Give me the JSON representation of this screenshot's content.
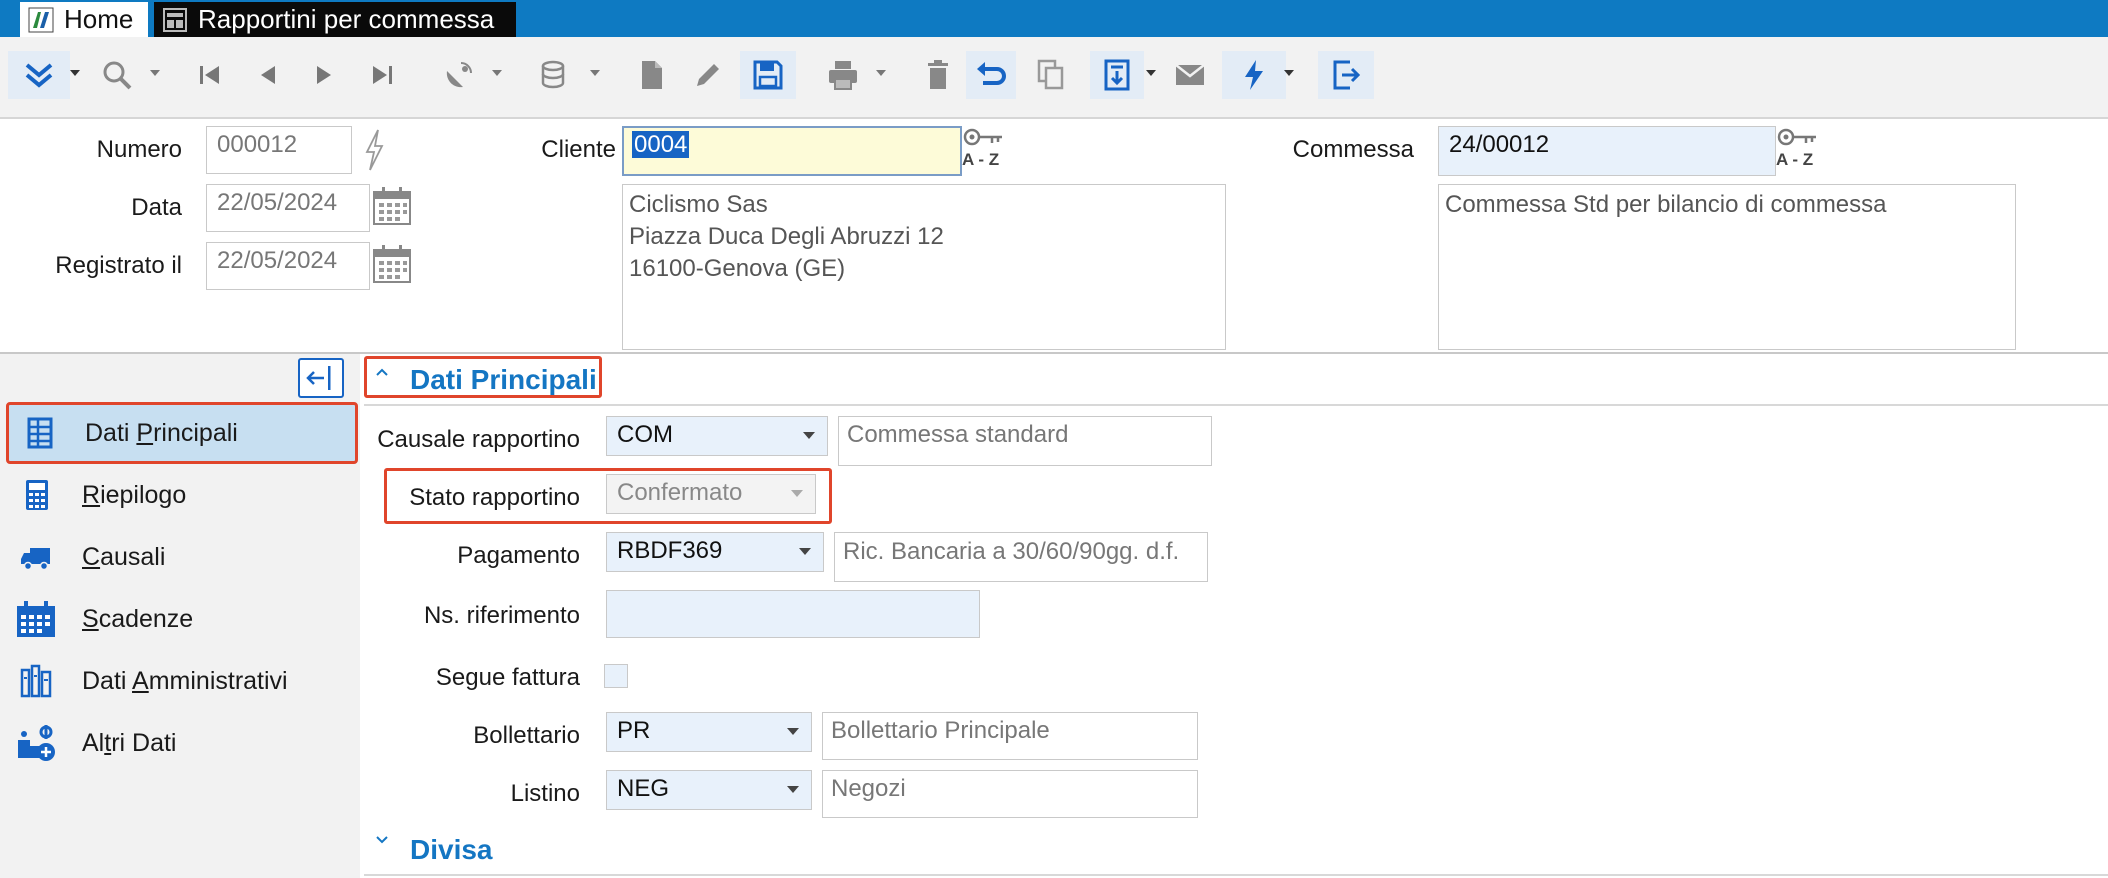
{
  "titlebar": {
    "tabs": [
      {
        "label": "Home"
      },
      {
        "label": "Rapportini per commessa"
      }
    ]
  },
  "toolbar": {
    "buttons": [
      "expand-icon",
      "search-icon",
      "first-record-icon",
      "previous-record-icon",
      "next-record-icon",
      "last-record-icon",
      "satellite-icon",
      "database-icon",
      "new-document-icon",
      "edit-icon",
      "save-icon",
      "print-icon",
      "delete-icon",
      "undo-icon",
      "copy-icon",
      "export-icon",
      "mail-icon",
      "lightning-icon",
      "exit-icon"
    ]
  },
  "header": {
    "numero": {
      "label": "Numero",
      "value": "000012"
    },
    "data": {
      "label": "Data",
      "value": "22/05/2024"
    },
    "registrato": {
      "label": "Registrato il",
      "value": "22/05/2024"
    },
    "cliente": {
      "label": "Cliente",
      "value": "0004",
      "az": "A - Z",
      "address": [
        "Ciclismo Sas",
        "Piazza Duca Degli Abruzzi 12",
        "16100-Genova (GE)"
      ]
    },
    "commessa": {
      "label": "Commessa",
      "value": "24/00012",
      "az": "A - Z",
      "description": "Commessa Std per bilancio di commessa"
    }
  },
  "sidebar": {
    "items": [
      {
        "pre": "Dati ",
        "key": "P",
        "post": "rincipali",
        "icon": "table-icon",
        "active": true
      },
      {
        "pre": "",
        "key": "R",
        "post": "iepilogo",
        "icon": "calculator-icon"
      },
      {
        "pre": "",
        "key": "C",
        "post": "ausali",
        "icon": "truck-icon"
      },
      {
        "pre": "",
        "key": "S",
        "post": "cadenze",
        "icon": "calendar-icon"
      },
      {
        "pre": "Dati ",
        "key": "A",
        "post": "mministrativi",
        "icon": "books-icon"
      },
      {
        "pre": "Al",
        "key": "t",
        "post": "ri Dati",
        "icon": "settings-add-icon"
      }
    ]
  },
  "main": {
    "section_title": "Dati Principali",
    "section2_title": "Divisa",
    "causale": {
      "label": "Causale rapportino",
      "value": "COM",
      "description": "Commessa standard"
    },
    "stato": {
      "label": "Stato rapportino",
      "value": "Confermato"
    },
    "pagamento": {
      "label": "Pagamento",
      "value": "RBDF369",
      "description": "Ric. Bancaria a 30/60/90gg. d.f."
    },
    "riferimento": {
      "label": "Ns. riferimento",
      "value": ""
    },
    "segue_fattura": {
      "label": "Segue fattura",
      "checked": false
    },
    "bollettario": {
      "label": "Bollettario",
      "value": "PR",
      "description": "Bollettario Principale"
    },
    "listino": {
      "label": "Listino",
      "value": "NEG",
      "description": "Negozi"
    }
  },
  "colors": {
    "accent": "#0e7ac2",
    "highlight_border": "#e0452b",
    "section_title": "#1476c3"
  }
}
